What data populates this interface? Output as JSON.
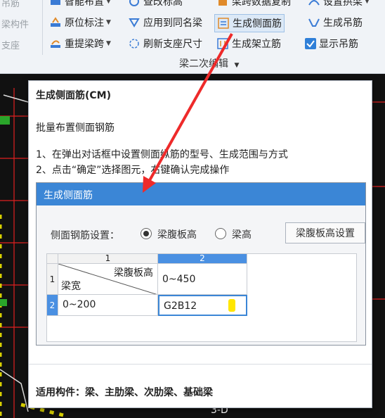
{
  "ribbon": {
    "left_col": [
      "吊筋",
      "梁构件",
      "支座"
    ],
    "row1": [
      "智能布置",
      "查改标高",
      "梁跨数据复制",
      "设置拱梁"
    ],
    "row2": [
      "原位标注",
      "应用到同名梁",
      "生成侧面筋",
      "生成吊筋"
    ],
    "row3": [
      "重提梁跨",
      "刷新支座尺寸",
      "生成架立筋",
      "显示吊筋"
    ],
    "group_label": "梁二次编辑"
  },
  "tooltip": {
    "title": "生成侧面筋(CM)",
    "subtitle": "批量布置侧面钢筋",
    "step1": "1、在弹出对话框中设置侧面纵筋的型号、生成范围与方式",
    "step2": "2、点击“确定”选择图元，右键确认完成操作",
    "footer": "适用构件：梁、主肋梁、次肋梁、基础梁"
  },
  "dialog": {
    "title": "生成侧面筋",
    "setting_label": "侧面钢筋设置：",
    "option1": "梁腹板高",
    "option2": "梁高",
    "button": "梁腹板高设置",
    "grid": {
      "col_headers": [
        "1",
        "2"
      ],
      "row_headers": [
        "1",
        "2"
      ],
      "corner_top": "梁腹板高",
      "corner_bottom": "梁宽",
      "r1c2": "0~450",
      "r2c1": "0~200",
      "r2c2": "G2B12"
    }
  },
  "cad": {
    "bottom_text": "3-D"
  }
}
